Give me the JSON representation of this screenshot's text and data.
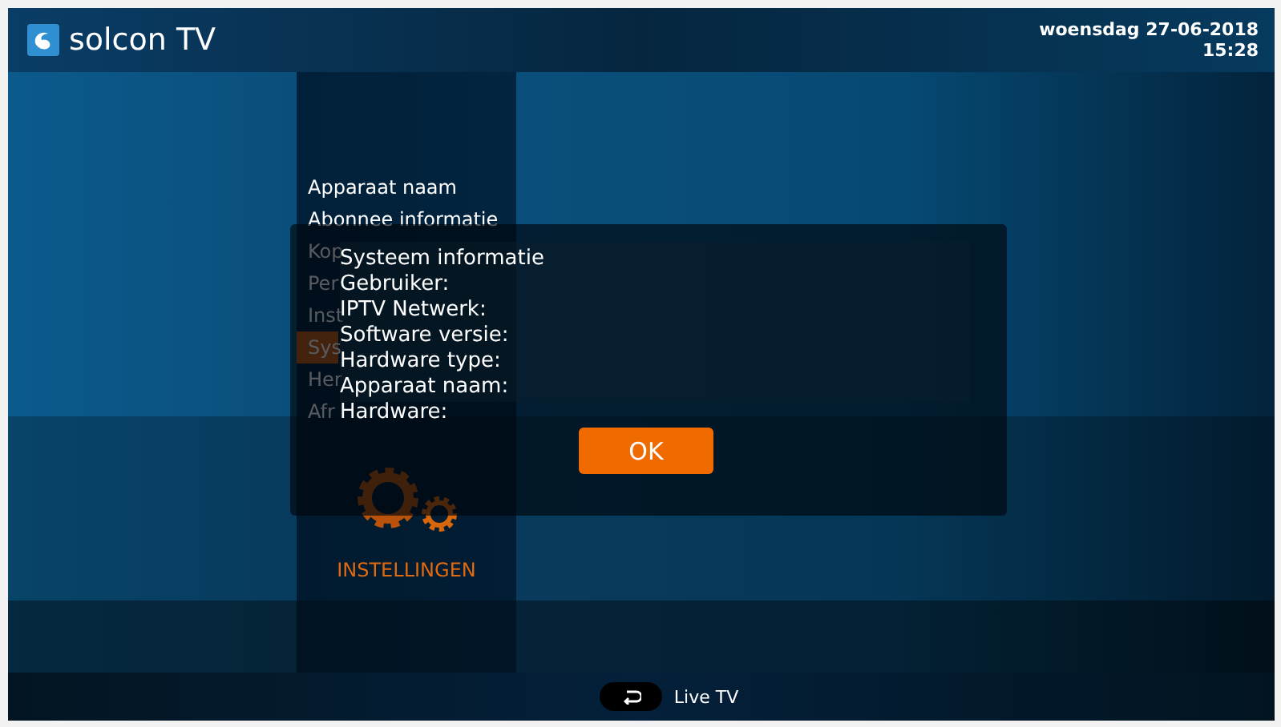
{
  "header": {
    "brand": "solcon TV",
    "date": "woensdag 27-06-2018",
    "time": "15:28"
  },
  "menu": {
    "items": [
      {
        "label": "Apparaat naam",
        "selected": false
      },
      {
        "label": "Abonnee informatie",
        "selected": false
      },
      {
        "label": "Kop",
        "selected": false
      },
      {
        "label": "Per",
        "selected": false
      },
      {
        "label": "Inst",
        "selected": false
      },
      {
        "label": "Sys",
        "selected": true
      },
      {
        "label": "Her",
        "selected": false
      },
      {
        "label": "Afr",
        "selected": false
      }
    ]
  },
  "category": {
    "label": "INSTELLINGEN"
  },
  "dialog": {
    "title": "Systeem informatie",
    "fields": [
      "Gebruiker:",
      "IPTV Netwerk:",
      "Software versie:",
      "Hardware type:",
      "Apparaat naam:",
      "Hardware:"
    ],
    "button": "OK"
  },
  "footer": {
    "label": "Live TV"
  }
}
